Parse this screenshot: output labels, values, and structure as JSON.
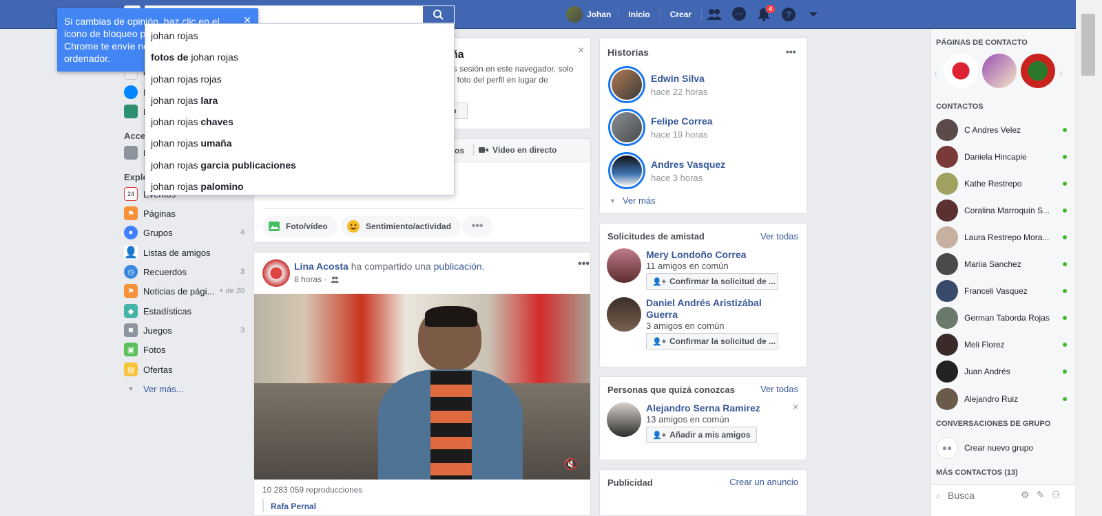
{
  "topbar": {
    "user": "Johan",
    "home": "Inicio",
    "create": "Crear",
    "notif_count": "4"
  },
  "chrome_tip": {
    "text": "Si cambias de opinión, haz clic en el icono de bloqueo para que Chrome te envíe notificaciones en tu ordenador.",
    "line1": "Si cambias de opinión, haz clic en el",
    "line2": "icono de bloqueo pa",
    "line3": "Chrome te envíe no",
    "line4": "ordenador."
  },
  "autocomplete": [
    {
      "pre": "johan rojas",
      "bold": ""
    },
    {
      "pre": "",
      "bold": "fotos de",
      "post": " johan rojas"
    },
    {
      "pre": "johan rojas rojas",
      "bold": ""
    },
    {
      "pre": "johan rojas ",
      "bold": "lara"
    },
    {
      "pre": "johan rojas ",
      "bold": "chaves"
    },
    {
      "pre": "johan rojas ",
      "bold": "umaña"
    },
    {
      "pre": "johan rojas ",
      "bold": "garcia publicaciones"
    },
    {
      "pre": "johan rojas ",
      "bold": "palomino"
    }
  ],
  "leftnav": {
    "partial_items": [
      "C",
      "M",
      "M"
    ],
    "section_access": "Acce",
    "section_explore": "Explo",
    "access_item": "F",
    "events": "Eventos",
    "items": [
      {
        "label": "Páginas",
        "count": ""
      },
      {
        "label": "Grupos",
        "count": "4"
      },
      {
        "label": "Listas de amigos",
        "count": ""
      },
      {
        "label": "Recuerdos",
        "count": "3"
      },
      {
        "label": "Noticias de pági...",
        "count": "+ de 20"
      },
      {
        "label": "Estadísticas",
        "count": ""
      },
      {
        "label": "Juegos",
        "count": "3"
      },
      {
        "label": "Fotos",
        "count": ""
      },
      {
        "label": "Ofertas",
        "count": ""
      }
    ],
    "see_more": "Ver más...",
    "events_date": "24"
  },
  "center": {
    "password_card": {
      "title_tail": "eña",
      "line1": "es sesión en este navegador, solo",
      "line2": "la foto del perfil en lugar de",
      "btn_tail": "no"
    },
    "composer": {
      "tab_video_tail": "deos",
      "tab_live": "Vídeo en directo",
      "photo": "Foto/vídeo",
      "feeling": "Sentimiento/actividad"
    },
    "post": {
      "author": "Lina Acosta",
      "action": " ha compartido una ",
      "object": "publicación.",
      "time": "8 horas · ",
      "views": "10 283 059 reproducciones",
      "footer_name": "Rafa Pernal"
    }
  },
  "stories": {
    "title": "Historias",
    "items": [
      {
        "name": "Edwin Silva",
        "time": "hace 22 horas"
      },
      {
        "name": "Felipe Correa",
        "time": "hace 19 horas"
      },
      {
        "name": "Andres Vasquez",
        "time": "hace 3 horas"
      }
    ],
    "see_more": "Ver más"
  },
  "friend_requests": {
    "title": "Solicitudes de amistad",
    "see_all": "Ver todas",
    "items": [
      {
        "name": "Mery Londoño Correa",
        "mutual": "11 amigos en común",
        "button": "Confirmar la solicitud de ..."
      },
      {
        "name": "Daniel Andrés Aristizábal Guerra",
        "name_l1": "Daniel Andrés Aristizábal",
        "name_l2": "Guerra",
        "mutual": "3 amigos en común",
        "button": "Confirmar la solicitud de ..."
      }
    ]
  },
  "pymk": {
    "title": "Personas que quizá conozcas",
    "see_all": "Ver todas",
    "name": "Alejandro Serna Ramirez",
    "mutual": "13 amigos en común",
    "button": "Añadir a mis amigos"
  },
  "ads": {
    "title": "Publicidad",
    "create": "Crear un anuncio"
  },
  "chat": {
    "pages_title": "PÁGINAS DE CONTACTO",
    "contacts_title": "CONTACTOS",
    "contacts": [
      "C Andres Velez",
      "Daniela Hincapie",
      "Kathe Restrepo",
      "Coralina Marroquín S...",
      "Laura Restrepo Mora...",
      "Mariia Sanchez",
      "Franceli Vasquez",
      "German Taborda Rojas",
      "Meli Florez",
      "Juan Andrés",
      "Alejandro Ruiz"
    ],
    "groups_title": "CONVERSACIONES DE GRUPO",
    "new_group": "Crear nuevo grupo",
    "more_contacts": "MÁS CONTACTOS (13)",
    "search_placeholder": "Busca"
  },
  "colors": {
    "brand": "#4267b2",
    "link": "#385898",
    "chrome_blue": "#4285f4",
    "online": "#42b72a"
  }
}
